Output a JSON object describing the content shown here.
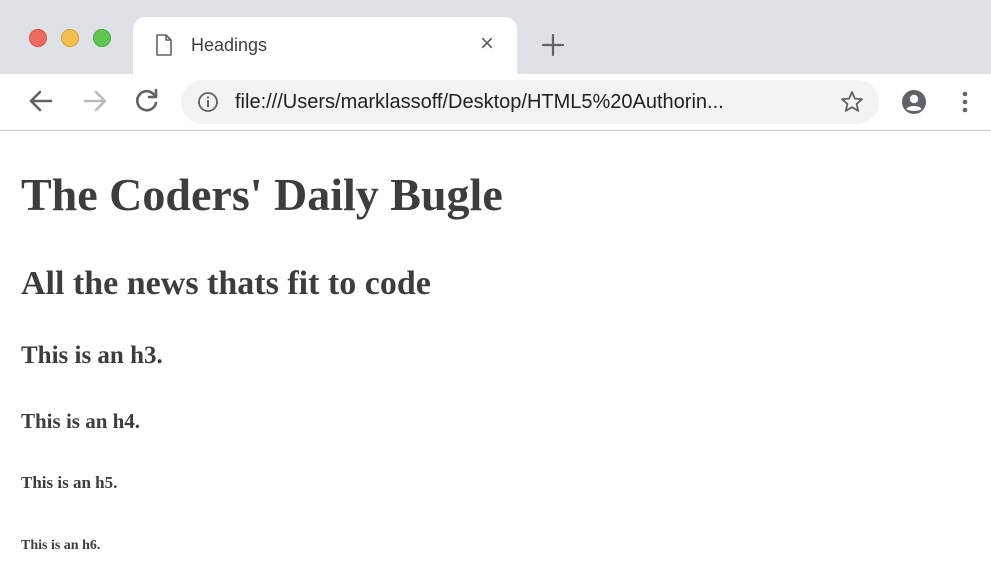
{
  "browser": {
    "tab": {
      "title": "Headings",
      "close_glyph": "×",
      "icon": "document-icon"
    },
    "new_tab_icon": "plus-icon",
    "toolbar": {
      "back_icon": "arrow-left-icon",
      "forward_icon": "arrow-right-icon",
      "reload_icon": "reload-icon",
      "info_icon": "info-icon",
      "url": "file:///Users/marklassoff/Desktop/HTML5%20Authorin...",
      "bookmark_icon": "star-icon",
      "profile_icon": "account-icon",
      "menu_icon": "kebab-menu-icon"
    },
    "colors": {
      "tabstrip": "#dee1e6",
      "close_red": "#ed6a5e",
      "minimize_yellow": "#f5bf4f",
      "zoom_green": "#61c554",
      "omnibox": "#f1f3f4",
      "text": "#3d3d3d"
    }
  },
  "page": {
    "h1": "The Coders' Daily Bugle",
    "h2": "All the news thats fit to code",
    "h3": "This is an h3.",
    "h4": "This is an h4.",
    "h5": "This is an h5.",
    "h6": "This is an h6."
  }
}
